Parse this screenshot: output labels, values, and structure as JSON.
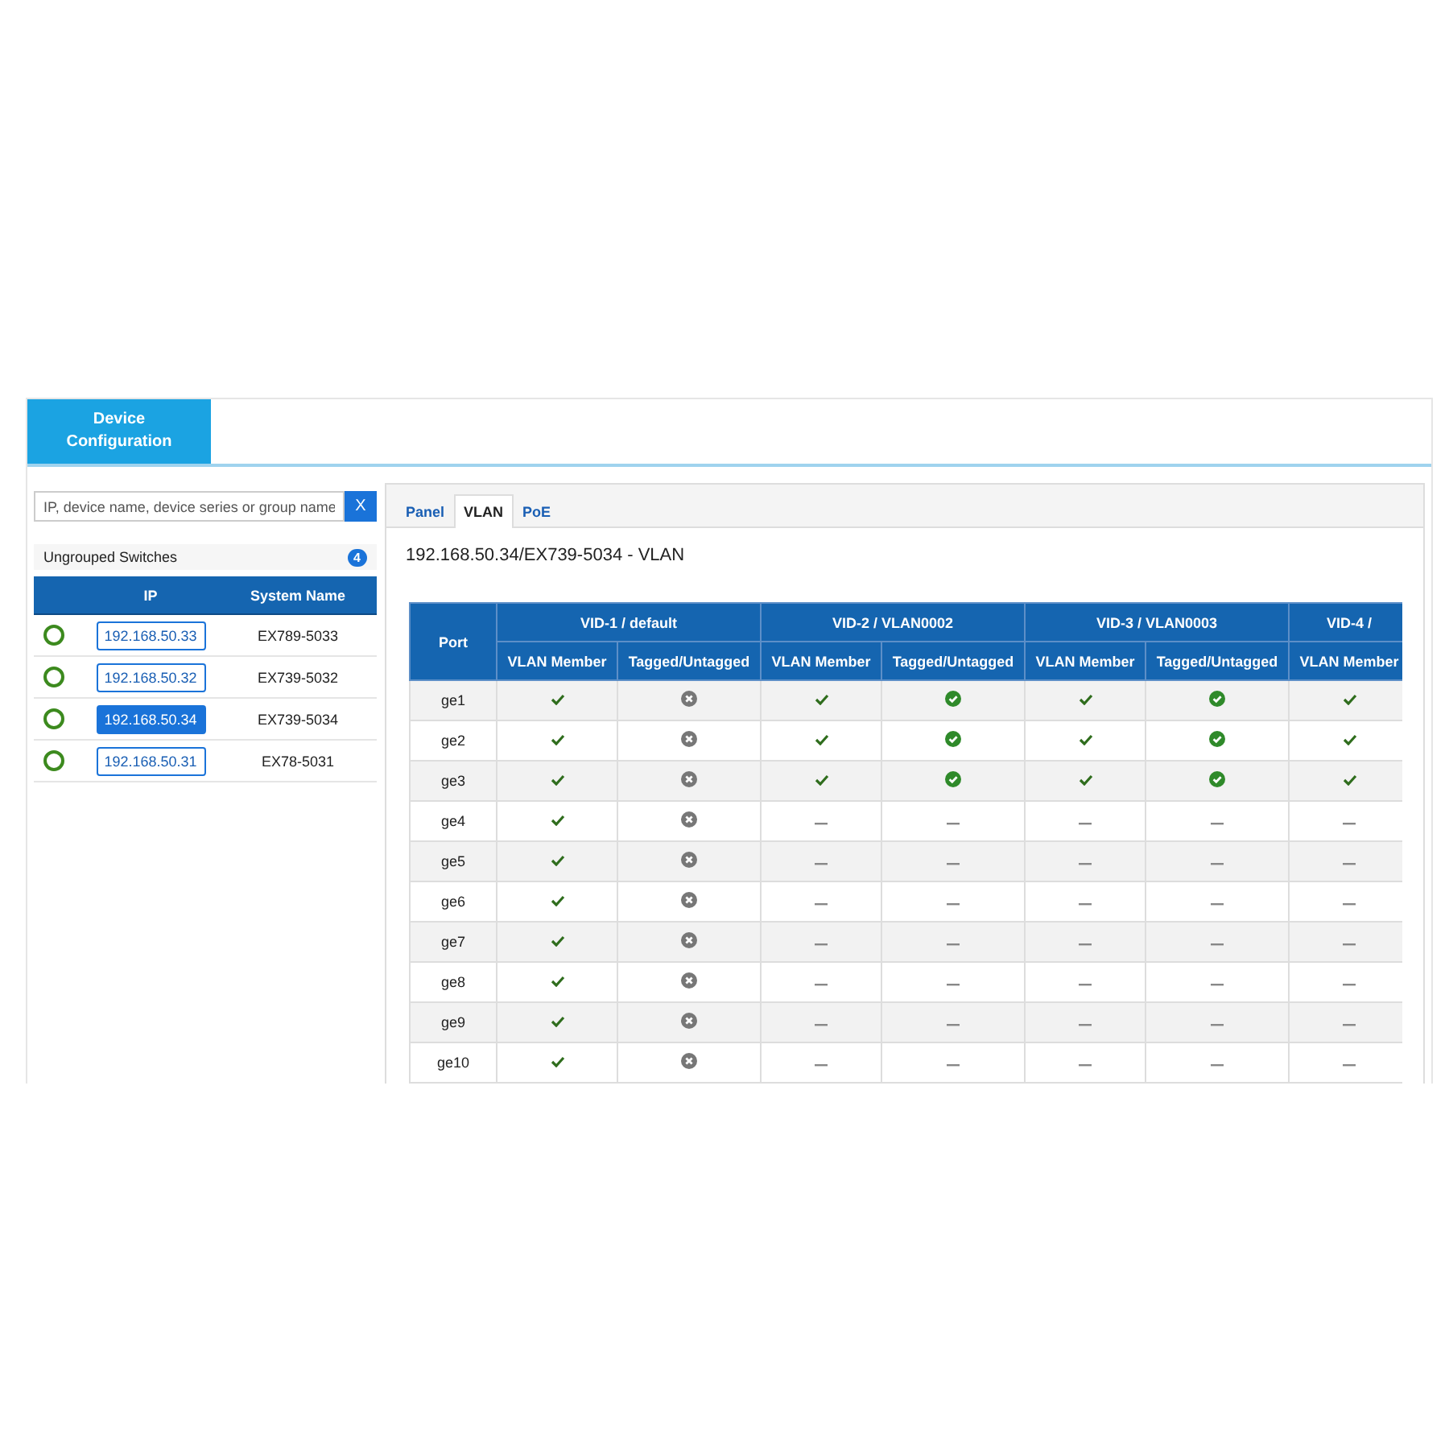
{
  "header_tab": {
    "label": "Device Configuration",
    "selected": true
  },
  "sidebar": {
    "search": {
      "placeholder": "IP, device name, device series or group name",
      "clear_button": "X"
    },
    "group": {
      "label": "Ungrouped Switches",
      "count": "4"
    },
    "columns": [
      "IP",
      "System Name"
    ],
    "switches": [
      {
        "ip": "192.168.50.33",
        "name": "EX789-5033",
        "selected": false
      },
      {
        "ip": "192.168.50.32",
        "name": "EX739-5032",
        "selected": false
      },
      {
        "ip": "192.168.50.34",
        "name": "EX739-5034",
        "selected": true
      },
      {
        "ip": "192.168.50.31",
        "name": "EX78-5031",
        "selected": false
      }
    ]
  },
  "tabs": [
    {
      "label": "Panel",
      "selected": false
    },
    {
      "label": "VLAN",
      "selected": true
    },
    {
      "label": "PoE",
      "selected": false
    }
  ],
  "title": "192.168.50.34/EX739-5034 - VLAN",
  "table": {
    "port_header": "Port",
    "groups": [
      {
        "label": "VID-1 / default",
        "columns": [
          "VLAN Member",
          "Tagged/Untagged"
        ]
      },
      {
        "label": "VID-2 / VLAN0002",
        "columns": [
          "VLAN Member",
          "Tagged/Untagged"
        ]
      },
      {
        "label": "VID-3 / VLAN0003",
        "columns": [
          "VLAN Member",
          "Tagged/Untagged"
        ]
      },
      {
        "label": "VID-4 /",
        "columns": [
          "VLAN Member"
        ]
      }
    ],
    "rows": [
      {
        "port": "ge1",
        "cells": [
          {
            "kind": "check"
          },
          {
            "kind": "untagged"
          },
          {
            "kind": "check"
          },
          {
            "kind": "tagged"
          },
          {
            "kind": "check"
          },
          {
            "kind": "tagged"
          },
          {
            "kind": "check"
          }
        ]
      },
      {
        "port": "ge2",
        "cells": [
          {
            "kind": "check"
          },
          {
            "kind": "untagged"
          },
          {
            "kind": "check"
          },
          {
            "kind": "tagged"
          },
          {
            "kind": "check"
          },
          {
            "kind": "tagged"
          },
          {
            "kind": "check"
          }
        ]
      },
      {
        "port": "ge3",
        "cells": [
          {
            "kind": "check"
          },
          {
            "kind": "untagged"
          },
          {
            "kind": "check"
          },
          {
            "kind": "tagged"
          },
          {
            "kind": "check"
          },
          {
            "kind": "tagged"
          },
          {
            "kind": "check"
          }
        ]
      },
      {
        "port": "ge4",
        "cells": [
          {
            "kind": "check"
          },
          {
            "kind": "untagged"
          },
          {
            "kind": "none"
          },
          {
            "kind": "none"
          },
          {
            "kind": "none"
          },
          {
            "kind": "none"
          },
          {
            "kind": "none"
          }
        ]
      },
      {
        "port": "ge5",
        "cells": [
          {
            "kind": "check"
          },
          {
            "kind": "untagged"
          },
          {
            "kind": "none"
          },
          {
            "kind": "none"
          },
          {
            "kind": "none"
          },
          {
            "kind": "none"
          },
          {
            "kind": "none"
          }
        ]
      },
      {
        "port": "ge6",
        "cells": [
          {
            "kind": "check"
          },
          {
            "kind": "untagged"
          },
          {
            "kind": "none"
          },
          {
            "kind": "none"
          },
          {
            "kind": "none"
          },
          {
            "kind": "none"
          },
          {
            "kind": "none"
          }
        ]
      },
      {
        "port": "ge7",
        "cells": [
          {
            "kind": "check"
          },
          {
            "kind": "untagged"
          },
          {
            "kind": "none"
          },
          {
            "kind": "none"
          },
          {
            "kind": "none"
          },
          {
            "kind": "none"
          },
          {
            "kind": "none"
          }
        ]
      },
      {
        "port": "ge8",
        "cells": [
          {
            "kind": "check"
          },
          {
            "kind": "untagged"
          },
          {
            "kind": "none"
          },
          {
            "kind": "none"
          },
          {
            "kind": "none"
          },
          {
            "kind": "none"
          },
          {
            "kind": "none"
          }
        ]
      },
      {
        "port": "ge9",
        "cells": [
          {
            "kind": "check"
          },
          {
            "kind": "untagged"
          },
          {
            "kind": "none"
          },
          {
            "kind": "none"
          },
          {
            "kind": "none"
          },
          {
            "kind": "none"
          },
          {
            "kind": "none"
          }
        ]
      },
      {
        "port": "ge10",
        "cells": [
          {
            "kind": "check"
          },
          {
            "kind": "untagged"
          },
          {
            "kind": "none"
          },
          {
            "kind": "none"
          },
          {
            "kind": "none"
          },
          {
            "kind": "none"
          },
          {
            "kind": "none"
          }
        ]
      }
    ]
  }
}
